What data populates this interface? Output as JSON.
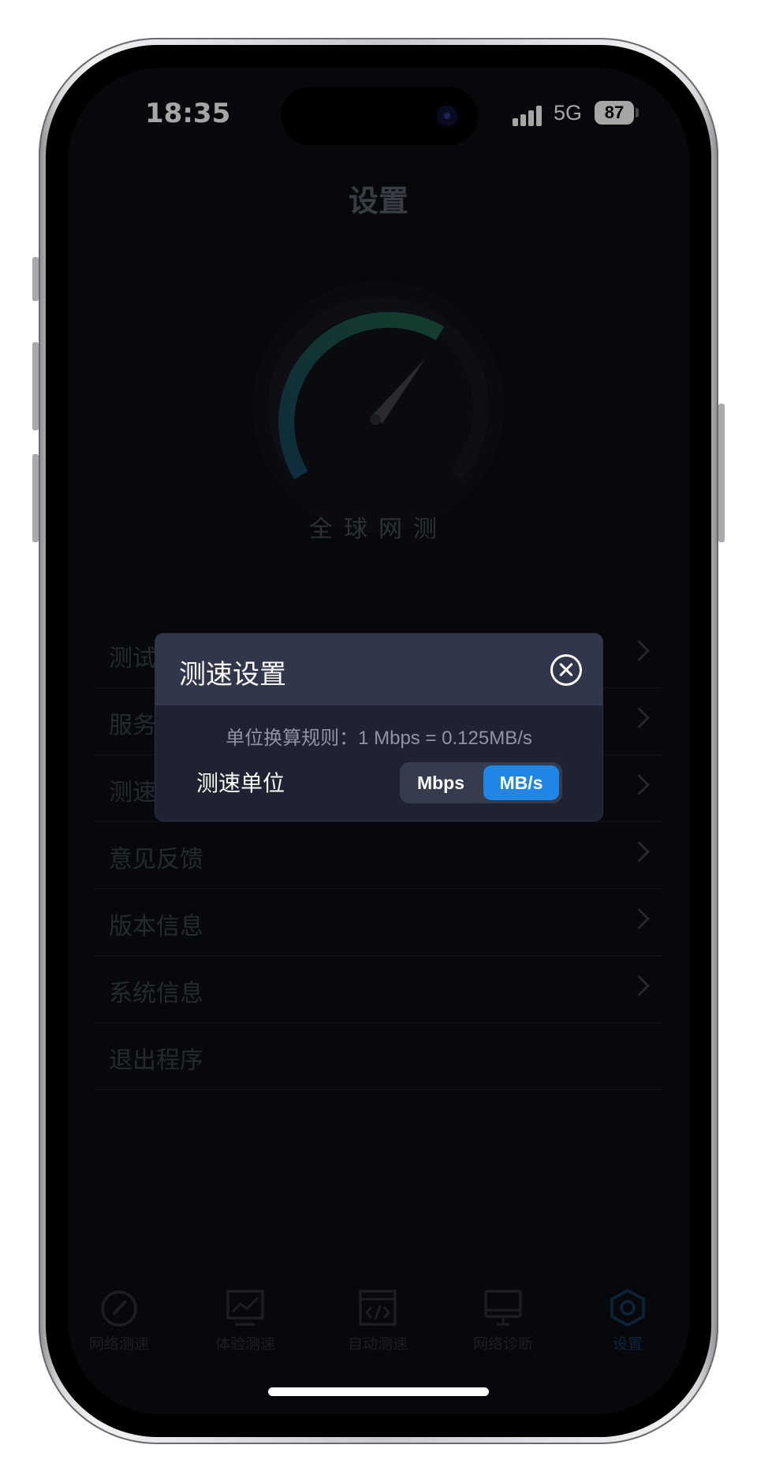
{
  "status_bar": {
    "time": "18:35",
    "network": "5G",
    "battery": "87"
  },
  "page": {
    "title": "设置",
    "brand": "全球网测"
  },
  "menu": {
    "items": [
      {
        "label": "测试"
      },
      {
        "label": "服务"
      },
      {
        "label": "测速"
      },
      {
        "label": "意见反馈"
      },
      {
        "label": "版本信息"
      },
      {
        "label": "系统信息"
      },
      {
        "label": "退出程序"
      }
    ]
  },
  "tabbar": {
    "items": [
      {
        "label": "网络测速",
        "icon": "speedometer-icon"
      },
      {
        "label": "体验测速",
        "icon": "chart-monitor-icon"
      },
      {
        "label": "自动测速",
        "icon": "code-window-icon"
      },
      {
        "label": "网络诊断",
        "icon": "monitor-icon"
      },
      {
        "label": "设置",
        "icon": "hexagon-settings-icon",
        "active": true
      }
    ]
  },
  "modal": {
    "title": "测速设置",
    "rule_text": "单位换算规则：1 Mbps =  0.125MB/s",
    "unit_label": "测速单位",
    "options": [
      {
        "label": "Mbps",
        "selected": false
      },
      {
        "label": "MB/s",
        "selected": true
      }
    ]
  },
  "colors": {
    "accent": "#1f86e6",
    "modal_bg": "#1f2331",
    "modal_header": "#31364a",
    "screen_bg": "#0c0d11"
  }
}
